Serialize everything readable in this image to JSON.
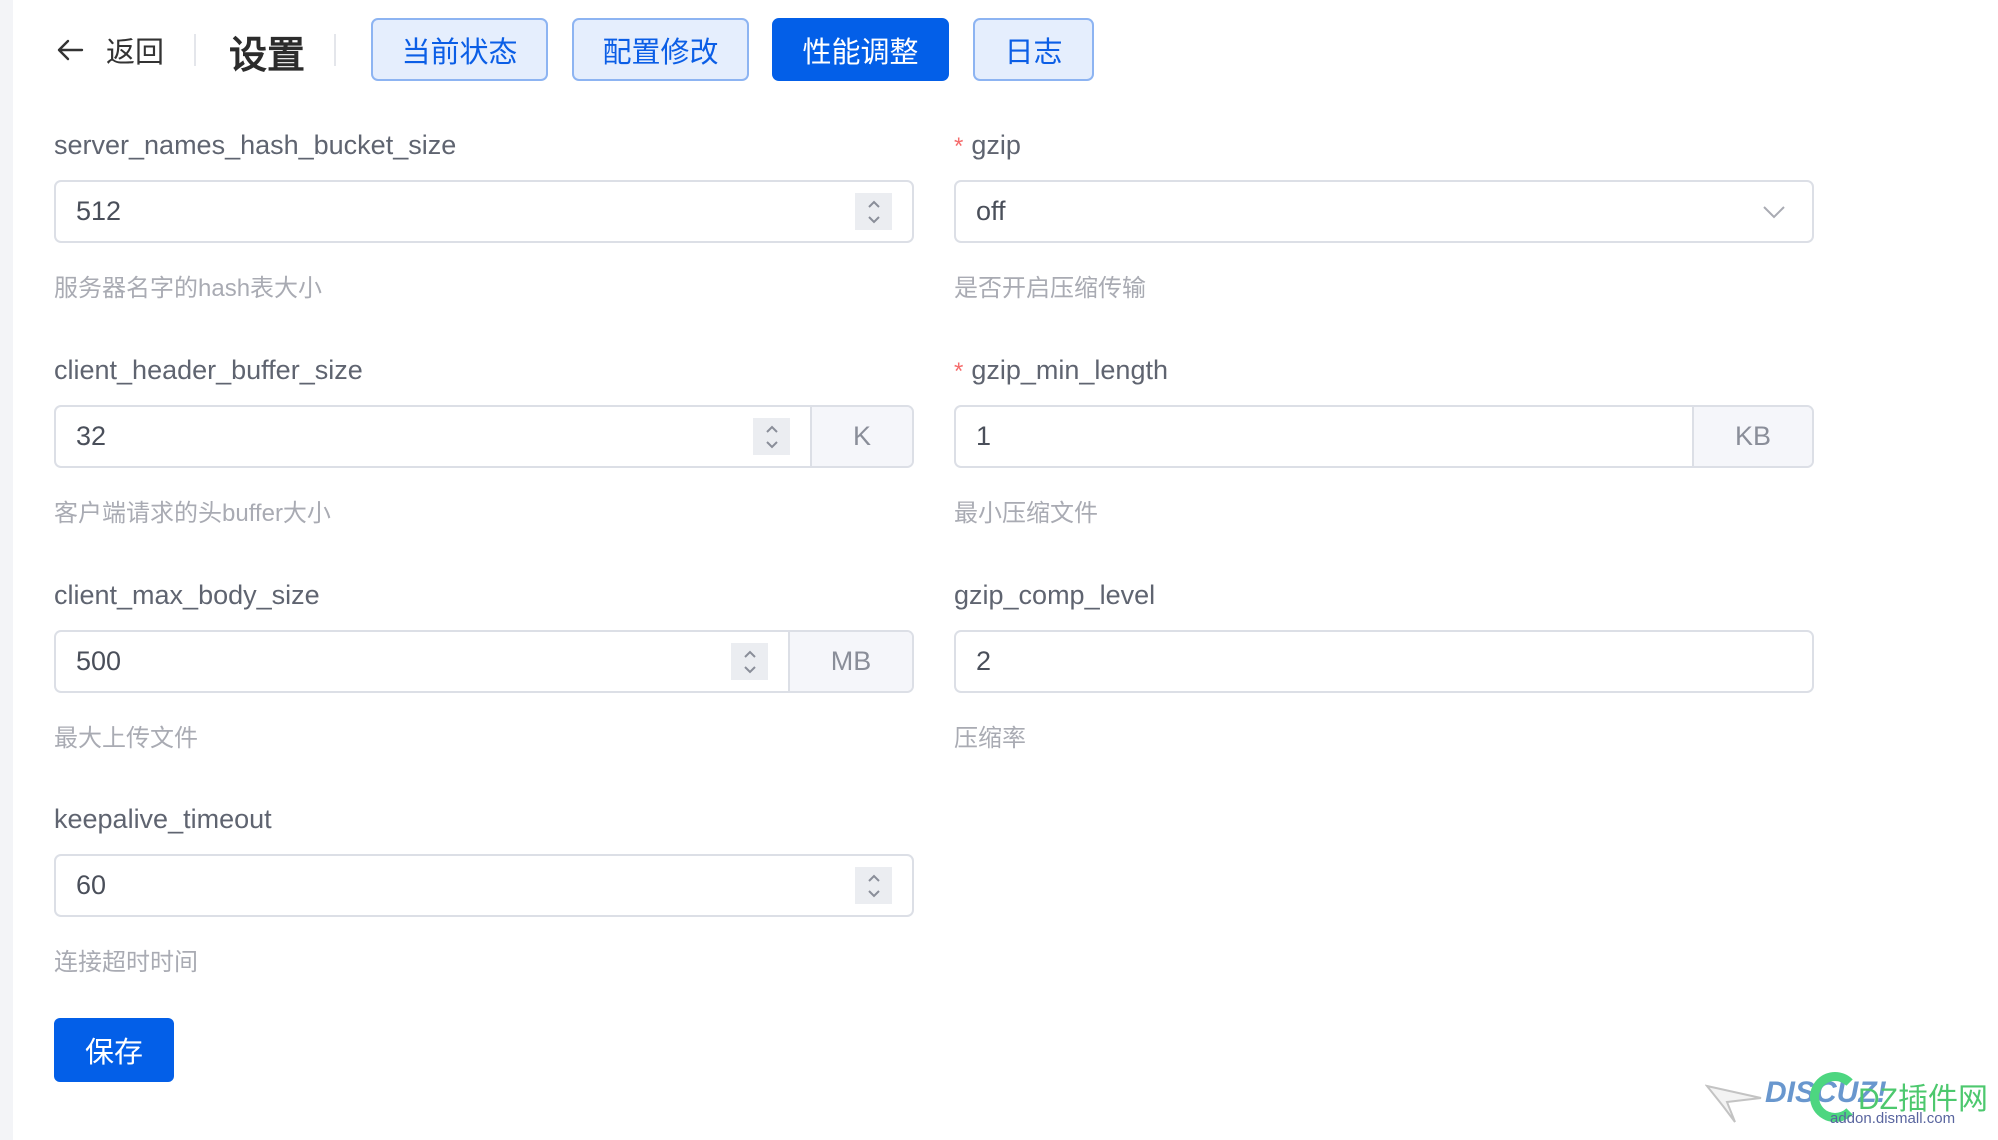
{
  "header": {
    "back_label": "返回",
    "title": "设置",
    "tabs": [
      {
        "label": "当前状态",
        "active": false
      },
      {
        "label": "配置修改",
        "active": false
      },
      {
        "label": "性能调整",
        "active": true
      },
      {
        "label": "日志",
        "active": false
      }
    ]
  },
  "form": {
    "fields": [
      {
        "key": "server_names_hash_bucket_size",
        "label": "server_names_hash_bucket_size",
        "required": false,
        "type": "number",
        "value": "512",
        "suffix": null,
        "hint": "服务器名字的hash表大小"
      },
      {
        "key": "gzip",
        "label": "gzip",
        "required": true,
        "type": "select",
        "value": "off",
        "suffix": null,
        "hint": "是否开启压缩传输"
      },
      {
        "key": "client_header_buffer_size",
        "label": "client_header_buffer_size",
        "required": false,
        "type": "number",
        "value": "32",
        "suffix": "K",
        "hint": "客户端请求的头buffer大小"
      },
      {
        "key": "gzip_min_length",
        "label": "gzip_min_length",
        "required": true,
        "type": "text",
        "value": "1",
        "suffix": "KB",
        "hint": "最小压缩文件"
      },
      {
        "key": "client_max_body_size",
        "label": "client_max_body_size",
        "required": false,
        "type": "number",
        "value": "500",
        "suffix": "MB",
        "hint": "最大上传文件"
      },
      {
        "key": "gzip_comp_level",
        "label": "gzip_comp_level",
        "required": false,
        "type": "text",
        "value": "2",
        "suffix": null,
        "hint": "压缩率"
      },
      {
        "key": "keepalive_timeout",
        "label": "keepalive_timeout",
        "required": false,
        "type": "number",
        "value": "60",
        "suffix": null,
        "hint": "连接超时时间"
      }
    ],
    "required_marker": "*",
    "save_label": "保存"
  },
  "watermark": {
    "brand": "DISCUZ!",
    "site_name": "DZ插件网",
    "url_text": "addon.dismall.com"
  },
  "colors": {
    "primary": "#035fe8",
    "tab_bg": "#e5eefd",
    "tab_border": "#8db4f2",
    "required": "#f56c6c",
    "hint": "#a9abb3"
  }
}
